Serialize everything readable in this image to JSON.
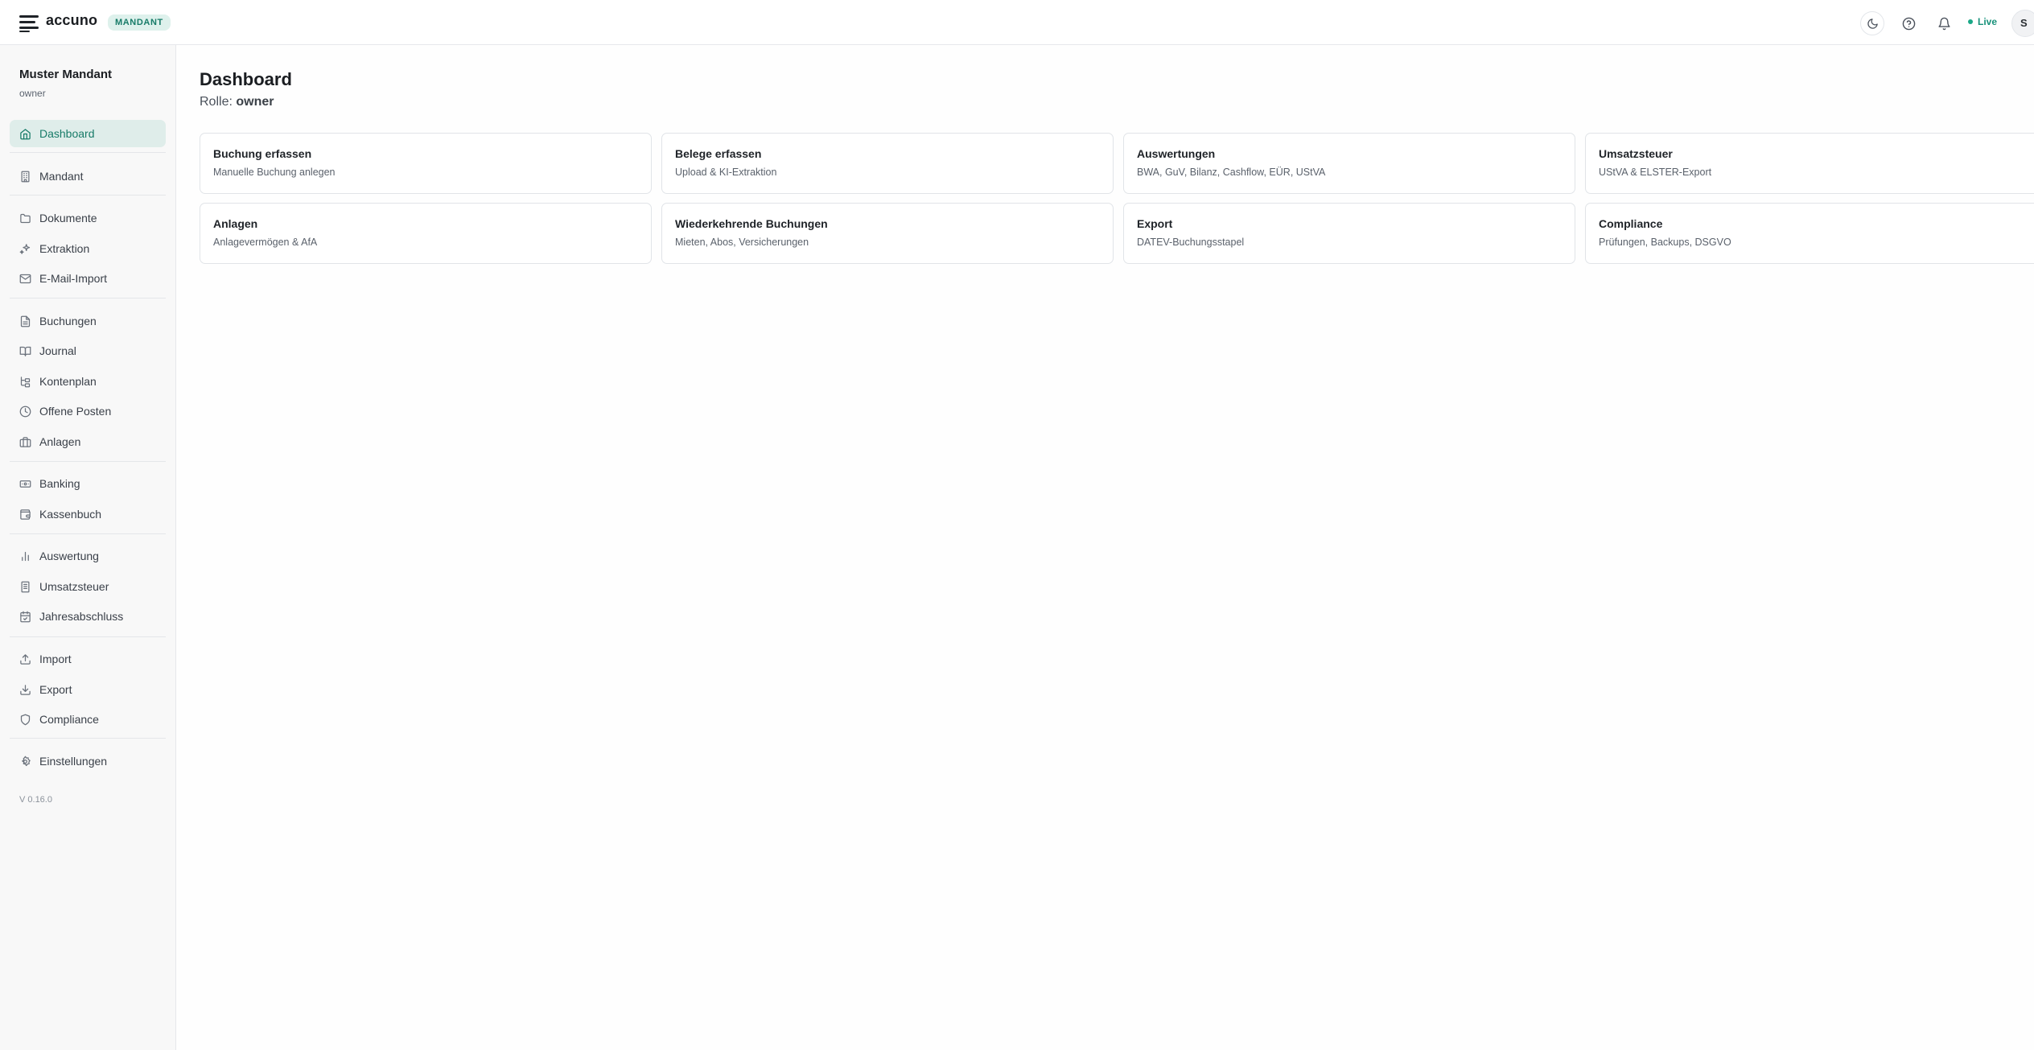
{
  "header": {
    "brand": "accuno",
    "badge": "MANDANT",
    "live_label": "Live",
    "avatar_initial": "S",
    "icons": [
      "menu-icon",
      "moon-icon",
      "help-icon",
      "bell-icon"
    ]
  },
  "sidebar": {
    "tenant_name": "Muster Mandant",
    "tenant_role": "owner",
    "items": [
      {
        "label": "Dashboard",
        "icon": "home-icon",
        "active": true
      },
      {
        "label": "Mandant",
        "icon": "building-icon"
      },
      {
        "label": "Dokumente",
        "icon": "folder-icon"
      },
      {
        "label": "Extraktion",
        "icon": "sparkles-icon"
      },
      {
        "label": "E-Mail-Import",
        "icon": "mail-icon"
      },
      {
        "label": "Buchungen",
        "icon": "file-text-icon"
      },
      {
        "label": "Journal",
        "icon": "book-open-icon"
      },
      {
        "label": "Kontenplan",
        "icon": "tree-icon"
      },
      {
        "label": "Offene Posten",
        "icon": "clock-icon"
      },
      {
        "label": "Anlagen",
        "icon": "briefcase-icon"
      },
      {
        "label": "Banking",
        "icon": "banknote-icon"
      },
      {
        "label": "Kassenbuch",
        "icon": "wallet-icon"
      },
      {
        "label": "Auswertung",
        "icon": "bar-chart-icon"
      },
      {
        "label": "Umsatzsteuer",
        "icon": "receipt-icon"
      },
      {
        "label": "Jahresabschluss",
        "icon": "calendar-check-icon"
      },
      {
        "label": "Import",
        "icon": "upload-icon"
      },
      {
        "label": "Export",
        "icon": "download-icon"
      },
      {
        "label": "Compliance",
        "icon": "shield-icon"
      },
      {
        "label": "Einstellungen",
        "icon": "settings-icon"
      }
    ],
    "version": "V 0.16.0"
  },
  "main": {
    "title": "Dashboard",
    "role_label": "Rolle:",
    "role_value": "owner",
    "cards": [
      {
        "title": "Buchung erfassen",
        "subtitle": "Manuelle Buchung anlegen"
      },
      {
        "title": "Belege erfassen",
        "subtitle": "Upload & KI-Extraktion"
      },
      {
        "title": "Auswertungen",
        "subtitle": "BWA, GuV, Bilanz, Cashflow, EÜR, UStVA"
      },
      {
        "title": "Umsatzsteuer",
        "subtitle": "UStVA & ELSTER-Export"
      },
      {
        "title": "Anlagen",
        "subtitle": "Anlagevermögen & AfA"
      },
      {
        "title": "Wiederkehrende Buchungen",
        "subtitle": "Mieten, Abos, Versicherungen"
      },
      {
        "title": "Export",
        "subtitle": "DATEV-Buchungsstapel"
      },
      {
        "title": "Compliance",
        "subtitle": "Prüfungen, Backups, DSGVO"
      }
    ]
  },
  "colors": {
    "accent": "#177b68",
    "accent_bg": "#dfedea",
    "live": "#1aa887"
  }
}
